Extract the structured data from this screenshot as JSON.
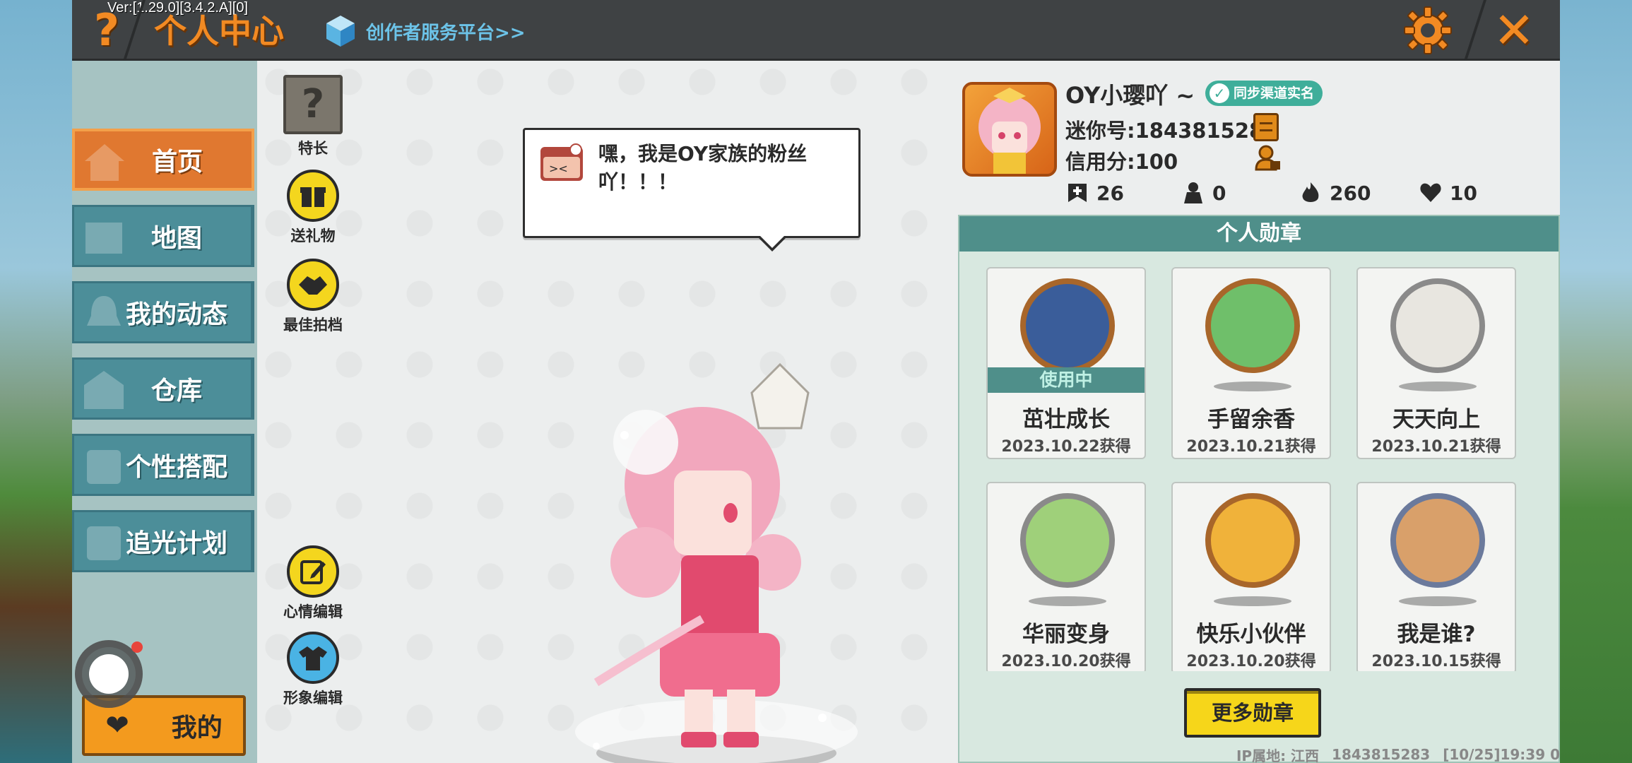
{
  "app": {
    "version": "Ver:[1.29.0][3.4.2.A][0]",
    "title": "个人中心",
    "creator_link": "创作者服务平台>>"
  },
  "icons": {
    "help": "?",
    "close": "✕",
    "specialty": "?",
    "heart": "❤"
  },
  "sidebar": {
    "items": [
      {
        "label": "首页",
        "active": true
      },
      {
        "label": "地图",
        "active": false
      },
      {
        "label": "我的动态",
        "active": false
      },
      {
        "label": "仓库",
        "active": false
      },
      {
        "label": "个性搭配",
        "active": false
      },
      {
        "label": "追光计划",
        "active": false
      }
    ],
    "mine_label": "我的"
  },
  "actions": {
    "specialty": "特长",
    "send_gift": "送礼物",
    "best_photo": "最佳拍档",
    "mood_edit": "心情编辑",
    "image_edit": "形象编辑"
  },
  "bubble": {
    "text": "嘿，我是OY家族的粉丝吖！！！"
  },
  "profile": {
    "nickname": "OY小璎吖 ~",
    "sync_badge": "同步渠道实名",
    "mini_id": "迷你号:1843815283",
    "credit": "信用分:100",
    "stats": [
      {
        "icon": "add-friend-icon",
        "value": "26"
      },
      {
        "icon": "follower-icon",
        "value": "0"
      },
      {
        "icon": "fire-icon",
        "value": "260"
      },
      {
        "icon": "likes-heart-icon",
        "value": "10"
      }
    ]
  },
  "medals": {
    "header": "个人勋章",
    "in_use_label": "使用中",
    "items": [
      {
        "name": "茁壮成长",
        "date": "2023.10.22获得",
        "in_use": true,
        "ring": "#a8662a",
        "fill": "#3a5d9a"
      },
      {
        "name": "手留余香",
        "date": "2023.10.21获得",
        "in_use": false,
        "ring": "#a8662a",
        "fill": "#6fbf6a"
      },
      {
        "name": "天天向上",
        "date": "2023.10.21获得",
        "in_use": false,
        "ring": "#8a8a8a",
        "fill": "#e8e6e0"
      },
      {
        "name": "华丽变身",
        "date": "2023.10.20获得",
        "in_use": false,
        "ring": "#8a8a8a",
        "fill": "#9fd07a"
      },
      {
        "name": "快乐小伙伴",
        "date": "2023.10.20获得",
        "in_use": false,
        "ring": "#a8662a",
        "fill": "#f0b23a"
      },
      {
        "name": "我是谁?",
        "date": "2023.10.15获得",
        "in_use": false,
        "ring": "#6b7a9c",
        "fill": "#d9a06a"
      }
    ],
    "more_button": "更多勋章"
  },
  "footer": {
    "ip": "IP属地: 江西",
    "uid": "1843815283",
    "time": "[10/25]19:39 0"
  },
  "colors": {
    "accent": "#f28a23",
    "sidebar_active": "#e07830",
    "teal": "#4f8f8a",
    "yellow": "#f6d61a"
  }
}
